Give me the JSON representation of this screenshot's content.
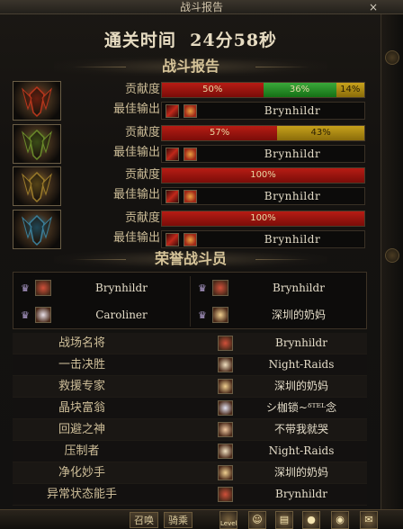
{
  "window": {
    "title": "战斗报告",
    "close_label": "×"
  },
  "clear_time": {
    "label": "通关时间",
    "value": "24分58秒"
  },
  "report_banner": "战斗报告",
  "honor_banner": "荣誉战斗员",
  "row_labels": {
    "contribution": "贡献度",
    "best_dps": "最佳输出"
  },
  "players": [
    {
      "avatar_icon": "fire-warrior-avatar-icon",
      "avatar_color": "#b8361c",
      "segments": [
        {
          "label": "50%",
          "value": 50,
          "color": "#b71c14"
        },
        {
          "label": "36%",
          "value": 36,
          "color": "#3aa83a"
        },
        {
          "label": "14%",
          "value": 14,
          "color": "#c8a21c"
        }
      ],
      "best_name": "Brynhildr"
    },
    {
      "avatar_icon": "green-knight-avatar-icon",
      "avatar_color": "#6a8a2a",
      "segments": [
        {
          "label": "57%",
          "value": 57,
          "color": "#b71c14"
        },
        {
          "label": "43%",
          "value": 43,
          "color": "#c8a21c"
        }
      ],
      "best_name": "Brynhildr"
    },
    {
      "avatar_icon": "gold-knight-avatar-icon",
      "avatar_color": "#9a7a2a",
      "segments": [
        {
          "label": "100%",
          "value": 100,
          "color": "#b71c14"
        }
      ],
      "best_name": "Brynhildr"
    },
    {
      "avatar_icon": "blue-knight-avatar-icon",
      "avatar_color": "#3a7f9a",
      "segments": [
        {
          "label": "100%",
          "value": 100,
          "color": "#b71c14"
        }
      ],
      "best_name": "Brynhildr"
    }
  ],
  "honor_members": [
    {
      "name": "Brynhildr",
      "face_color": "#d0503a"
    },
    {
      "name": "Brynhildr",
      "face_color": "#d0503a"
    },
    {
      "name": "Caroliner",
      "face_color": "#e8e0e8"
    },
    {
      "name": "深圳的奶妈",
      "face_color": "#f0d090"
    }
  ],
  "awards": [
    {
      "title": "战场名将",
      "player": "Brynhildr",
      "face_color": "#d0503a"
    },
    {
      "title": "一击决胜",
      "player": "Night-Raids",
      "face_color": "#f0e0c0"
    },
    {
      "title": "救援专家",
      "player": "深圳的奶妈",
      "face_color": "#f0d090"
    },
    {
      "title": "晶块富翁",
      "player": "シ枷锁~ᵟᵀᴱᴸ念",
      "face_color": "#e0e0f0"
    },
    {
      "title": "回避之神",
      "player": "不带我就哭",
      "face_color": "#f0c8a0"
    },
    {
      "title": "压制者",
      "player": "Night-Raids",
      "face_color": "#f0e0c0"
    },
    {
      "title": "净化妙手",
      "player": "深圳的奶妈",
      "face_color": "#f0d090"
    },
    {
      "title": "异常状态能手",
      "player": "Brynhildr",
      "face_color": "#d0503a"
    }
  ],
  "bottom_bar": {
    "btn1": "召唤",
    "btn2": "骑乘",
    "level_label": "Level"
  }
}
